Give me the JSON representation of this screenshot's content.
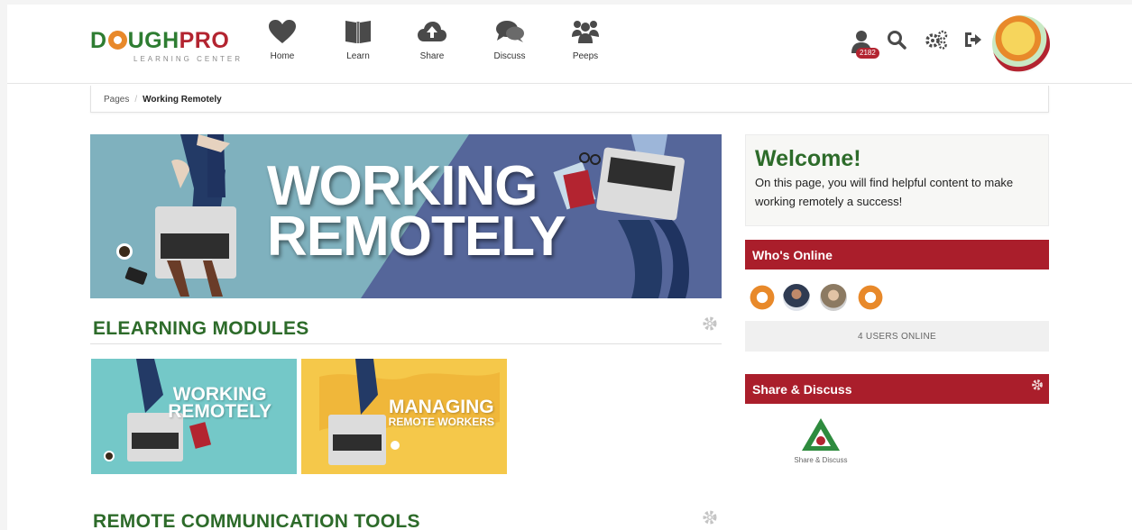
{
  "brand": {
    "name_part1": "D",
    "name_part2": "UGH",
    "name_part3": "PRO",
    "tagline": "LEARNING CENTER"
  },
  "nav": [
    {
      "label": "Home",
      "icon": "heart-icon"
    },
    {
      "label": "Learn",
      "icon": "book-icon"
    },
    {
      "label": "Share",
      "icon": "cloud-upload-icon"
    },
    {
      "label": "Discuss",
      "icon": "chat-bubbles-icon"
    },
    {
      "label": "Peeps",
      "icon": "people-icon"
    }
  ],
  "header_tools": {
    "user_badge_count": "2182",
    "icons": [
      "user-icon",
      "search-icon",
      "gears-icon",
      "sign-out-icon"
    ]
  },
  "breadcrumb": {
    "root": "Pages",
    "current": "Working Remotely"
  },
  "hero": {
    "line1": "WORKING",
    "line2": "REMOTELY"
  },
  "sections": {
    "elearning": "ELEARNING MODULES",
    "comm_tools": "REMOTE COMMUNICATION TOOLS"
  },
  "modules": [
    {
      "title": "WORKING",
      "title2": "REMOTELY",
      "subtitle": ""
    },
    {
      "title": "MANAGING",
      "title2": "",
      "subtitle": "REMOTE WORKERS"
    }
  ],
  "welcome": {
    "heading": "Welcome!",
    "body": "On this page, you will find helpful content to make working remotely a success!"
  },
  "whos_online": {
    "title": "Who's Online",
    "count_text": "4 USERS ONLINE"
  },
  "share_discuss": {
    "title": "Share & Discuss",
    "link_caption": "Share & Discuss"
  },
  "colors": {
    "brand_green": "#2d6b2a",
    "brand_red": "#aa1e2b",
    "donut_orange": "#e8892a"
  }
}
